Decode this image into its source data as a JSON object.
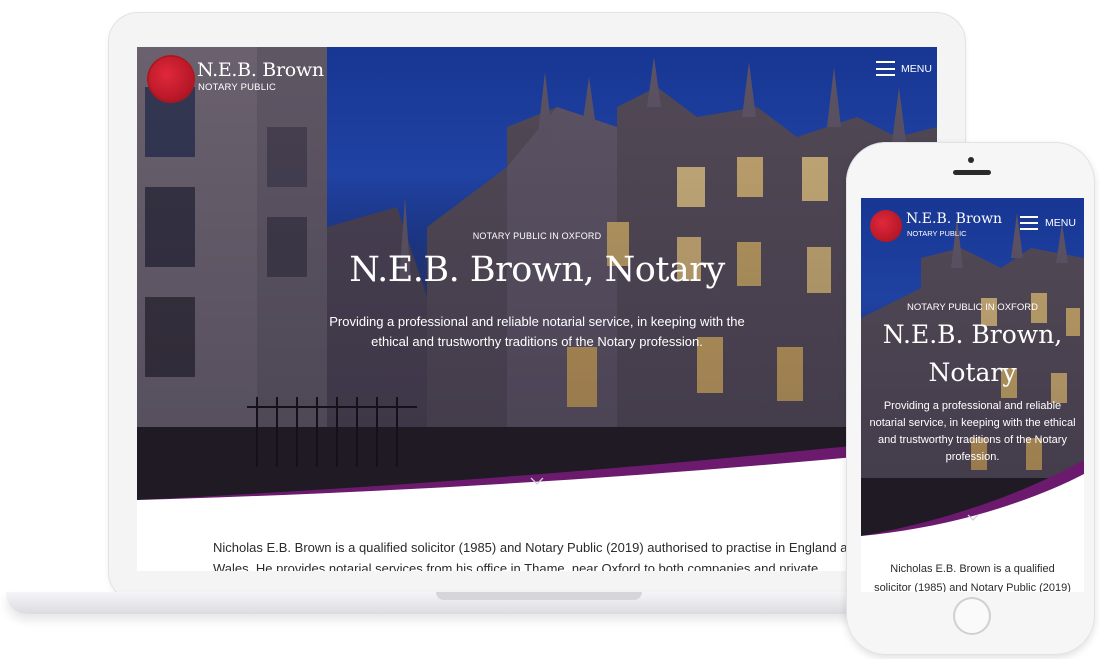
{
  "brand": {
    "name": "N.E.B. Brown",
    "tagline": "NOTARY PUBLIC"
  },
  "nav": {
    "menu_label": "MENU"
  },
  "hero": {
    "eyebrow": "NOTARY PUBLIC IN OXFORD",
    "title": "N.E.B. Brown, Notary",
    "title_mobile_line1": "N.E.B. Brown,",
    "title_mobile_line2": "Notary",
    "copy": "Providing a professional and reliable notarial service, in keeping with the ethical and trustworthy traditions of the Notary profession."
  },
  "intro": {
    "desktop_line1": "Nicholas E.B. Brown is a qualified solicitor (1985) and Notary Public (2019) authorised to practise in England and",
    "desktop_line2": "Wales.  He provides notarial services from his office in Thame, near Oxford to both companies and private",
    "mobile_line1": "Nicholas E.B. Brown is a qualified",
    "mobile_line2": "solicitor (1985) and Notary Public (2019)"
  },
  "colors": {
    "accent_purple": "#6b1a6e",
    "seal_red": "#c8182a",
    "sky_blue": "#2550c4"
  },
  "icons": {
    "menu": "hamburger-icon",
    "scroll": "chevron-down-icon",
    "logo": "wax-seal-icon"
  }
}
